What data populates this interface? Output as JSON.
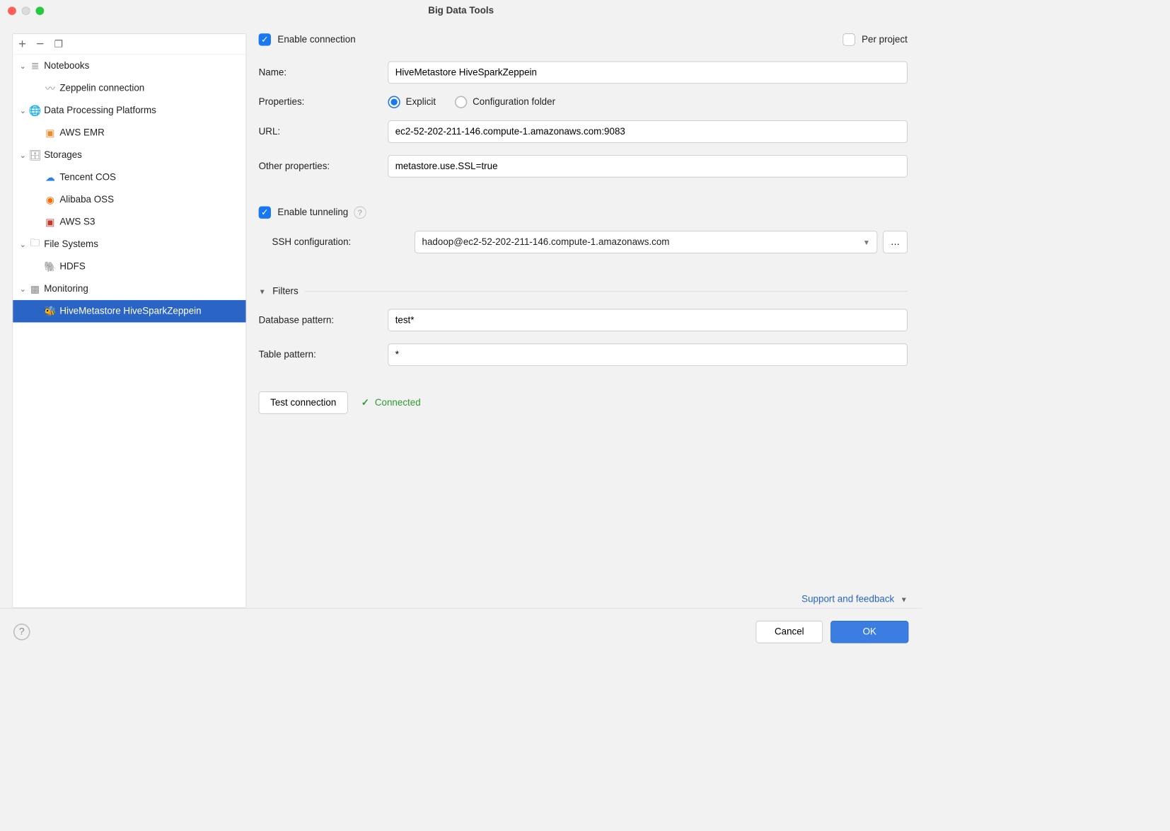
{
  "window": {
    "title": "Big Data Tools"
  },
  "sidebar": {
    "groups": [
      {
        "label": "Notebooks",
        "items": [
          {
            "label": "Zeppelin connection",
            "icon": "attachment-icon"
          }
        ]
      },
      {
        "label": "Data Processing Platforms",
        "items": [
          {
            "label": "AWS EMR",
            "icon": "emr-icon"
          }
        ]
      },
      {
        "label": "Storages",
        "items": [
          {
            "label": "Tencent COS",
            "icon": "cos-icon"
          },
          {
            "label": "Alibaba OSS",
            "icon": "oss-icon"
          },
          {
            "label": "AWS S3",
            "icon": "s3-icon"
          }
        ]
      },
      {
        "label": "File Systems",
        "items": [
          {
            "label": "HDFS",
            "icon": "hdfs-icon"
          }
        ]
      },
      {
        "label": "Monitoring",
        "items": [
          {
            "label": "HiveMetastore HiveSparkZeppein",
            "icon": "hive-icon",
            "selected": true
          }
        ]
      }
    ]
  },
  "form": {
    "enable_connection": "Enable connection",
    "per_project": "Per project",
    "name_label": "Name:",
    "name_value": "HiveMetastore HiveSparkZeppein",
    "properties_label": "Properties:",
    "properties_options": {
      "explicit": "Explicit",
      "config_folder": "Configuration folder"
    },
    "url_label": "URL:",
    "url_value": "ec2-52-202-211-146.compute-1.amazonaws.com:9083",
    "other_props_label": "Other properties:",
    "other_props_value": "metastore.use.SSL=true",
    "enable_tunneling": "Enable tunneling",
    "ssh_label": "SSH configuration:",
    "ssh_value": "hadoop@ec2-52-202-211-146.compute-1.amazonaws.com",
    "filters_title": "Filters",
    "db_pattern_label": "Database pattern:",
    "db_pattern_value": "test*",
    "table_pattern_label": "Table pattern:",
    "table_pattern_value": "*",
    "test_connection": "Test connection",
    "connected": "Connected",
    "support": "Support and feedback"
  },
  "footer": {
    "cancel": "Cancel",
    "ok": "OK"
  }
}
